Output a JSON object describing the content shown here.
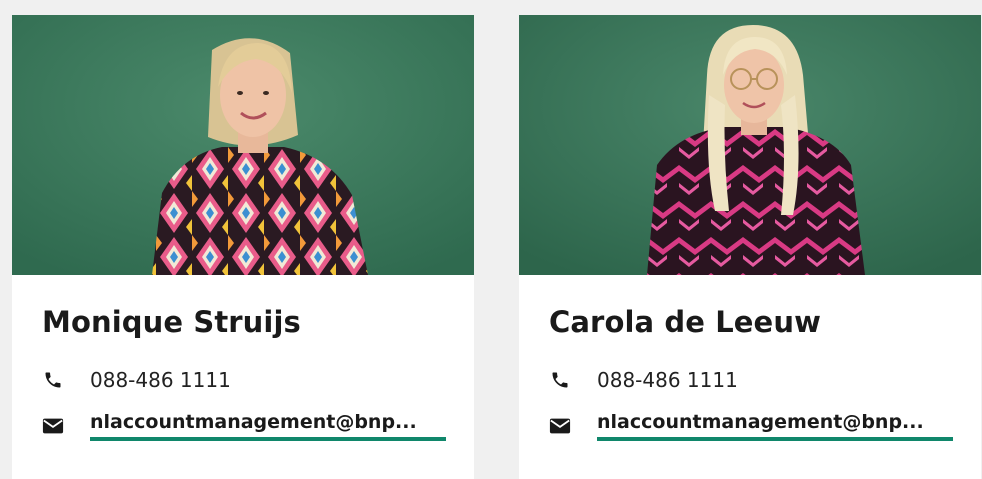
{
  "contacts": [
    {
      "name": "Monique Struijs",
      "phone": "088-486 1111",
      "email": "nlaccountmanagement@bnp...",
      "photo_icon": "person-photo",
      "phone_icon": "phone-icon",
      "email_icon": "envelope-icon"
    },
    {
      "name": "Carola de Leeuw",
      "phone": "088-486 1111",
      "email": "nlaccountmanagement@bnp...",
      "photo_icon": "person-photo",
      "phone_icon": "phone-icon",
      "email_icon": "envelope-icon"
    }
  ],
  "colors": {
    "page_bg": "#f0f0f0",
    "card_bg": "#ffffff",
    "accent_underline": "#10876b",
    "photo_wall": "#3e7a5c"
  }
}
